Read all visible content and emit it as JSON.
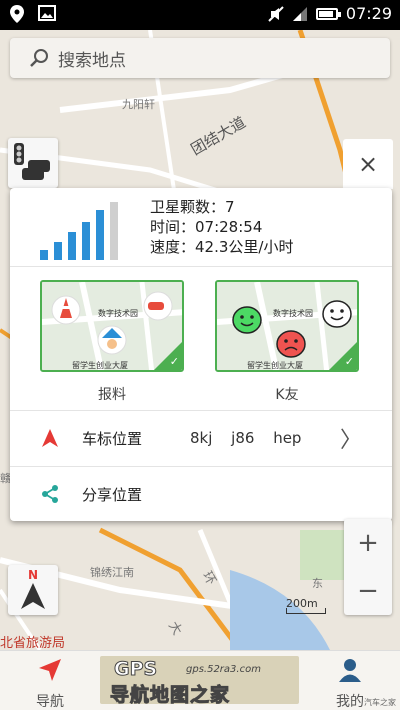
{
  "status_bar": {
    "time": "07:29"
  },
  "search": {
    "placeholder": "搜索地点"
  },
  "map": {
    "labels": {
      "jiuyangxuan": "九阳轩",
      "tuanjie": "团结大道",
      "jinjiang": "锦绣江南",
      "dong": "东",
      "lvyou": "北省旅游局",
      "huan": "环",
      "da": "大",
      "xiang": "赣"
    },
    "scale": "200m"
  },
  "panel": {
    "satellite_count": "卫星颗数：7",
    "time": "时间：07:28:54",
    "speed": "速度：42.3公里/小时",
    "cards": [
      {
        "label": "报料",
        "street1": "数字技术园",
        "street2": "留学生创业大厦"
      },
      {
        "label": "K友",
        "street1": "数字技术园",
        "street2": "留学生创业大厦"
      }
    ],
    "car_position": {
      "label": "车标位置",
      "options": "8kj j86 hep"
    },
    "share_position": {
      "label": "分享位置"
    }
  },
  "controls": {
    "close": "×",
    "zoom_in": "+",
    "zoom_out": "−",
    "compass": "N"
  },
  "bottom_nav": {
    "navigate": "导航",
    "mine": "我的",
    "banner_logo": "GPS",
    "banner_url": "gps.52ra3.com",
    "banner_title": "导航地图之家",
    "watermark": "汽车之家"
  },
  "colors": {
    "accent_green": "#4caf50",
    "signal_blue": "#2b8fd6",
    "arrow_red": "#e53935",
    "share_teal": "#26a69a",
    "road_orange": "#f0a030"
  }
}
